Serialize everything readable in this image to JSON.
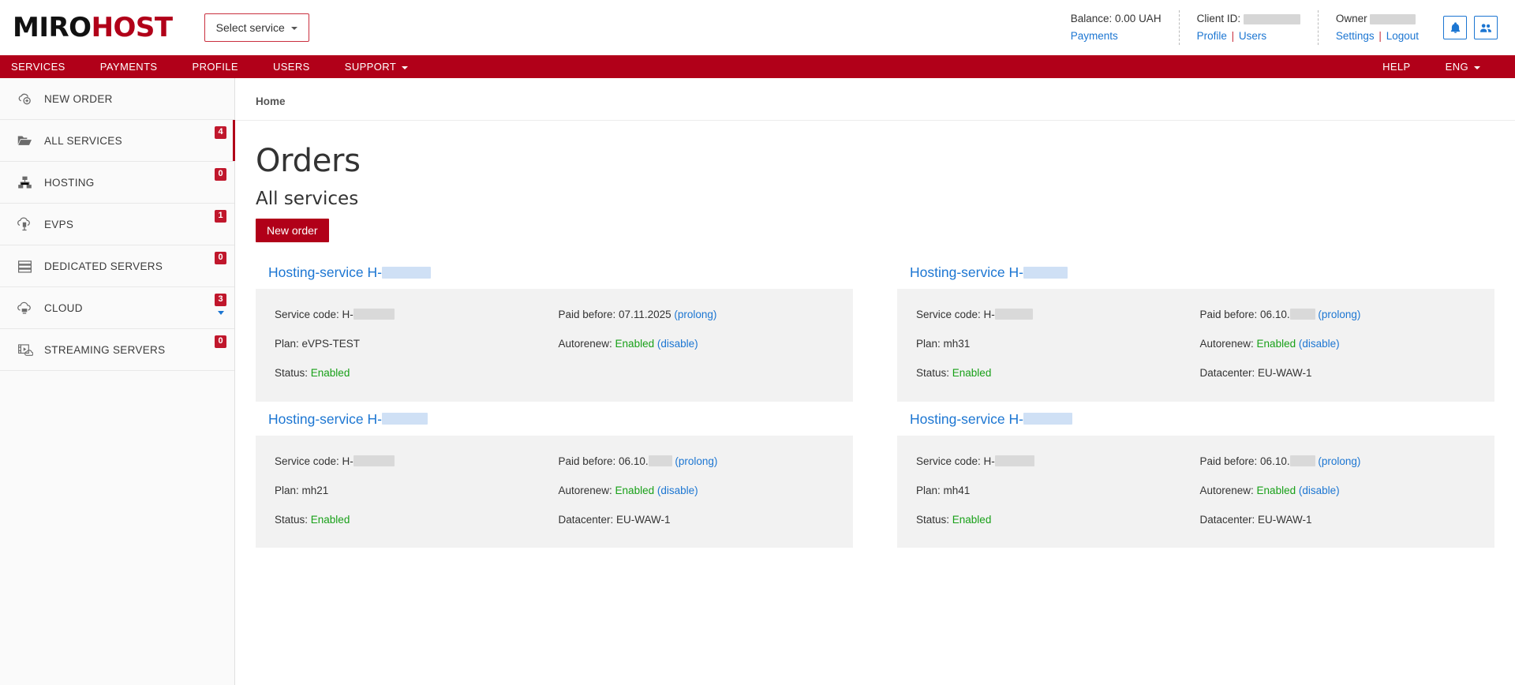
{
  "header": {
    "logo_miro": "MIRO",
    "logo_host": "HOST",
    "select_service": "Select service",
    "balance_label": "Balance: 0.00 UAH",
    "payments_link": "Payments",
    "client_id_label": "Client ID:",
    "profile_link": "Profile",
    "client_sep": "|",
    "users_link": "Users",
    "owner_label": "Owner",
    "settings_link": "Settings",
    "owner_sep": "|",
    "logout_link": "Logout",
    "bell_icon": "bell-icon",
    "users_icon": "users-icon"
  },
  "nav": {
    "items": [
      {
        "label": "SERVICES",
        "caret": false
      },
      {
        "label": "PAYMENTS",
        "caret": false
      },
      {
        "label": "PROFILE",
        "caret": false
      },
      {
        "label": "USERS",
        "caret": false
      },
      {
        "label": "SUPPORT",
        "caret": true
      }
    ],
    "right_items": [
      {
        "label": "HELP",
        "caret": false
      },
      {
        "label": "ENG",
        "caret": true
      }
    ]
  },
  "sidebar": {
    "items": [
      {
        "label": "NEW ORDER",
        "icon": "cloud-plus-icon",
        "badge": null,
        "active": false,
        "expandable": false
      },
      {
        "label": "ALL SERVICES",
        "icon": "folder-icon",
        "badge": "4",
        "active": true,
        "expandable": false
      },
      {
        "label": "HOSTING",
        "icon": "network-icon",
        "badge": "0",
        "active": false,
        "expandable": false
      },
      {
        "label": "EVPS",
        "icon": "cloud-server-icon",
        "badge": "1",
        "active": false,
        "expandable": false
      },
      {
        "label": "DEDICATED SERVERS",
        "icon": "server-stack-icon",
        "badge": "0",
        "active": false,
        "expandable": false
      },
      {
        "label": "CLOUD",
        "icon": "cloud-icon",
        "badge": "3",
        "active": false,
        "expandable": true
      },
      {
        "label": "STREAMING SERVERS",
        "icon": "streaming-icon",
        "badge": "0",
        "active": false,
        "expandable": false
      }
    ]
  },
  "main": {
    "breadcrumb": "Home",
    "title": "Orders",
    "subtitle": "All services",
    "new_order_button": "New order",
    "labels": {
      "service_code": "Service code: H-",
      "plan": "Plan: ",
      "status": "Status: ",
      "paid_before": "Paid before: ",
      "autorenew": "Autorenew: ",
      "datacenter": "Datacenter: ",
      "prolong": "(prolong)",
      "disable": "(disable)"
    },
    "cards": [
      {
        "title_prefix": "Hosting-service H-",
        "title_redacted_width": 62,
        "code_redacted_width": 52,
        "plan": "eVPS-TEST",
        "status": "Enabled",
        "paid_before": "07.11.2025",
        "paid_redacted_width": 0,
        "autorenew": "Enabled",
        "datacenter": null
      },
      {
        "title_prefix": "Hosting-service H-",
        "title_redacted_width": 56,
        "code_redacted_width": 48,
        "plan": "mh31",
        "status": "Enabled",
        "paid_before": "06.10.",
        "paid_redacted_width": 32,
        "autorenew": "Enabled",
        "datacenter": "EU-WAW-1"
      },
      {
        "title_prefix": "Hosting-service H-",
        "title_redacted_width": 58,
        "code_redacted_width": 52,
        "plan": "mh21",
        "status": "Enabled",
        "paid_before": "06.10.",
        "paid_redacted_width": 30,
        "autorenew": "Enabled",
        "datacenter": "EU-WAW-1"
      },
      {
        "title_prefix": "Hosting-service H-",
        "title_redacted_width": 62,
        "code_redacted_width": 50,
        "plan": "mh41",
        "status": "Enabled",
        "paid_before": "06.10.",
        "paid_redacted_width": 32,
        "autorenew": "Enabled",
        "datacenter": "EU-WAW-1"
      }
    ]
  },
  "colors": {
    "brand_red": "#b10019",
    "link_blue": "#1c76d2",
    "status_green": "#18a018",
    "card_bg": "#f2f2f2"
  }
}
